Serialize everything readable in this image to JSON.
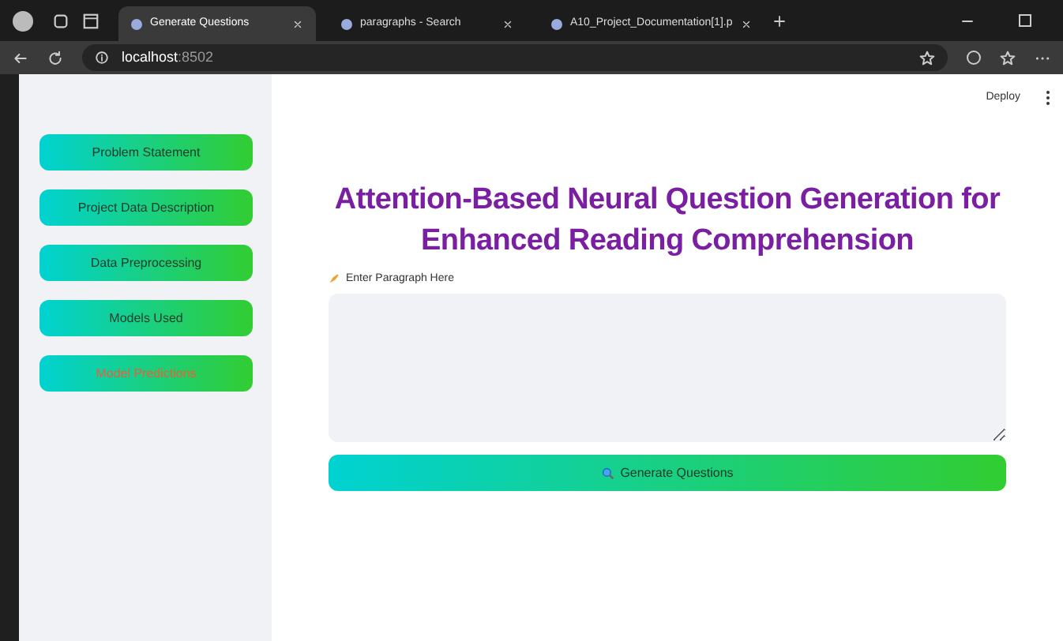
{
  "browser": {
    "tabs": [
      {
        "label": "Generate Questions",
        "selected": true
      },
      {
        "label": "paragraphs - Search",
        "selected": false
      },
      {
        "label": "A10_Project_Documentation[1].p",
        "selected": false
      }
    ],
    "address": {
      "host": "localhost",
      "port": ":8502"
    }
  },
  "toolbar": {
    "deploy": "Deploy"
  },
  "sidebar": {
    "items": [
      {
        "label": "Problem Statement",
        "selected": false
      },
      {
        "label": "Project Data Description",
        "selected": false
      },
      {
        "label": "Data Preprocessing",
        "selected": false
      },
      {
        "label": "Models Used",
        "selected": false
      },
      {
        "label": "Model Predictions",
        "selected": true
      }
    ]
  },
  "main": {
    "title": "Attention-Based Neural Question Generation for Enhanced Reading Comprehension",
    "field_label": "Enter Paragraph Here",
    "button": "Generate Questions"
  }
}
